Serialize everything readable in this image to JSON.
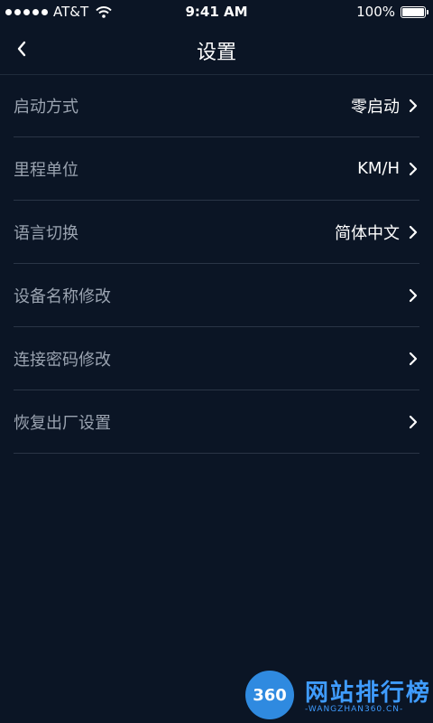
{
  "status_bar": {
    "carrier": "AT&T",
    "time": "9:41 AM",
    "battery": "100%",
    "battery_level": 1.0
  },
  "nav": {
    "title": "设置"
  },
  "settings": [
    {
      "label": "启动方式",
      "value": "零启动"
    },
    {
      "label": "里程单位",
      "value": "KM/H"
    },
    {
      "label": "语言切换",
      "value": "简体中文"
    },
    {
      "label": "设备名称修改",
      "value": ""
    },
    {
      "label": "连接密码修改",
      "value": ""
    },
    {
      "label": "恢复出厂设置",
      "value": ""
    }
  ],
  "watermark": {
    "logo_text": "360",
    "name": "网站排行榜",
    "url": "-WANGZHAN360.CN-"
  },
  "colors": {
    "background": "#0b1525",
    "label": "#9aa3b0",
    "value": "#ffffff",
    "divider": "#2a3546"
  }
}
